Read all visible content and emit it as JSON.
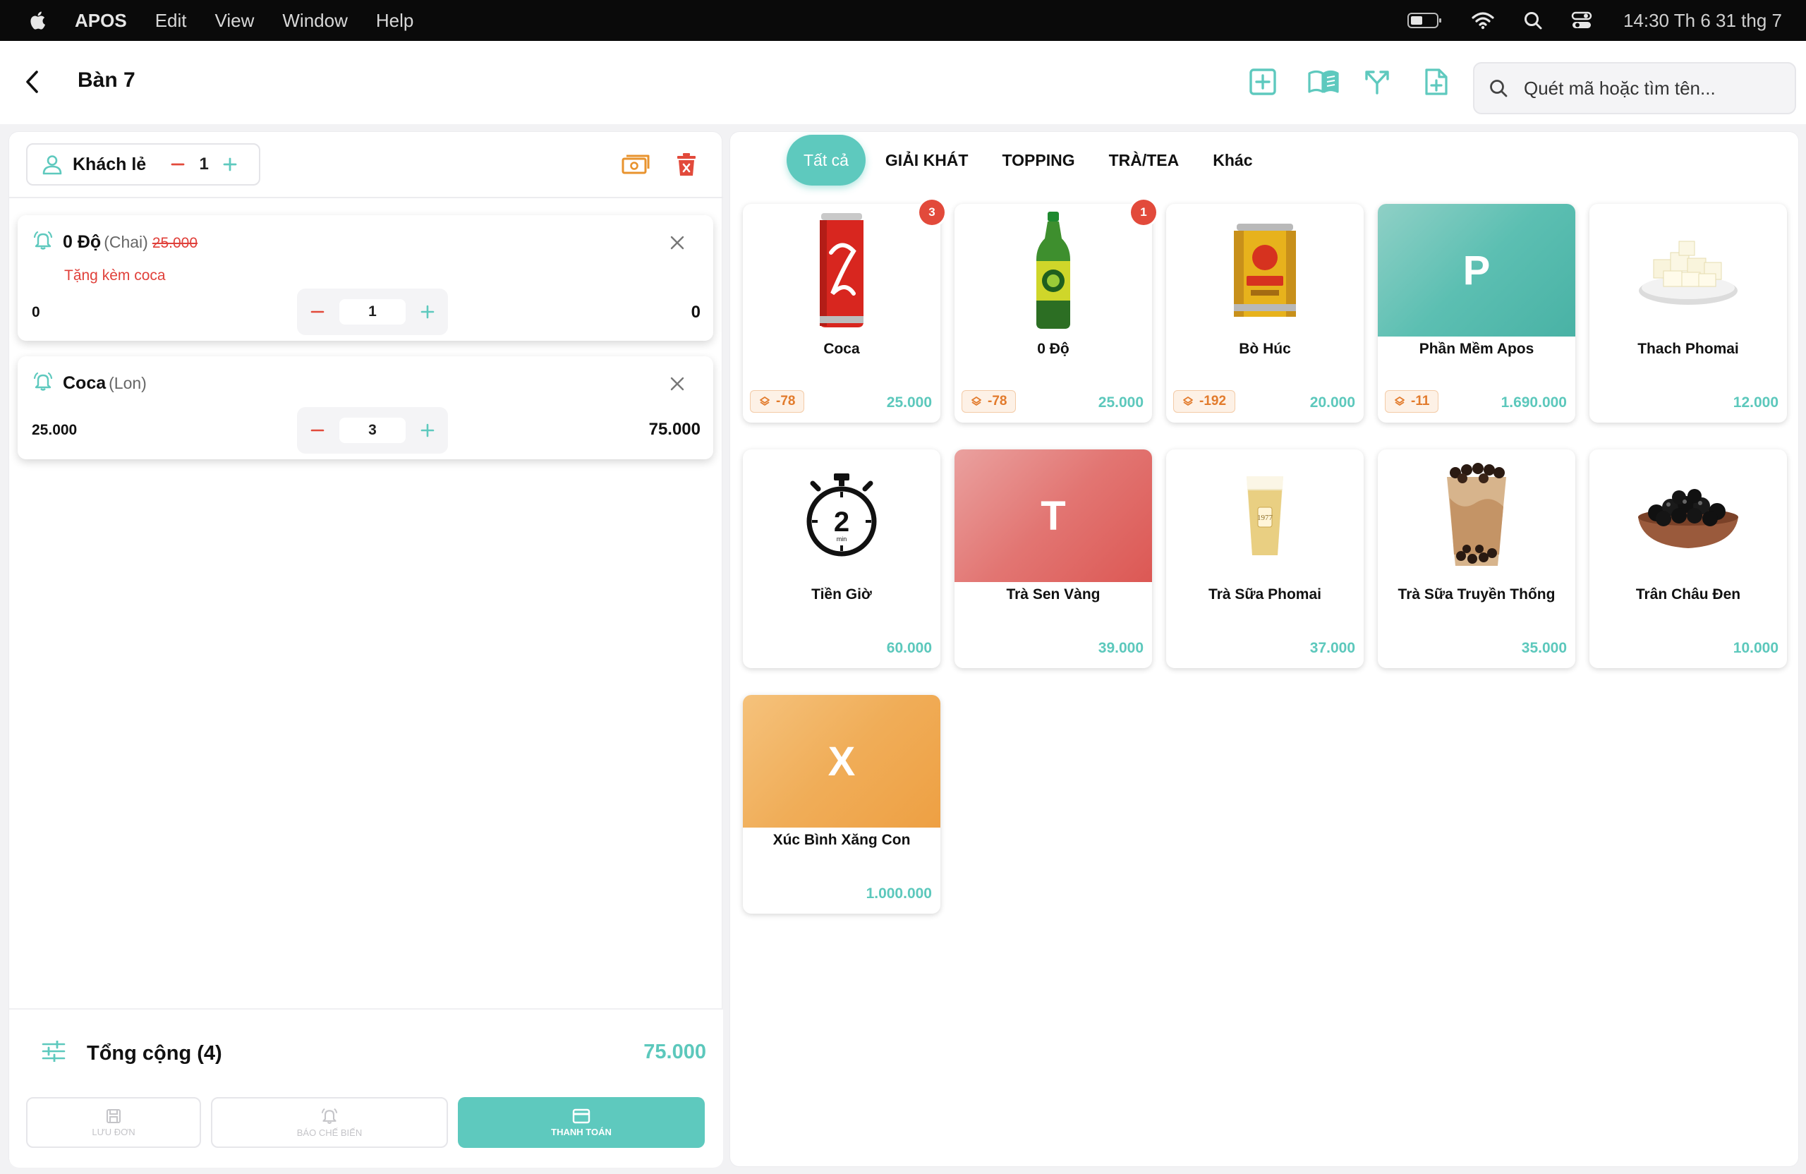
{
  "menubar": {
    "app_name": "APOS",
    "items": [
      "Edit",
      "View",
      "Window",
      "Help"
    ],
    "clock": "14:30 Th 6 31 thg 7"
  },
  "header": {
    "title": "Bàn 7",
    "search_placeholder": "Quét mã hoặc tìm tên..."
  },
  "order": {
    "customer_name": "Khách lẻ",
    "customer_count": "1",
    "items": [
      {
        "name": "0 Độ",
        "unit": "(Chai)",
        "old_price": "25.000",
        "note": "Tặng kèm coca",
        "price": "0",
        "qty": "1",
        "total": "0"
      },
      {
        "name": "Coca",
        "unit": "(Lon)",
        "price": "25.000",
        "qty": "3",
        "total": "75.000"
      }
    ],
    "total_label": "Tổng cộng (4)",
    "total_value": "75.000",
    "buttons": {
      "save": "LƯU ĐƠN",
      "kitchen": "BÁO CHẾ BIẾN",
      "pay": "THANH TOÁN"
    }
  },
  "categories": [
    "Tất cả",
    "GIẢI KHÁT",
    "TOPPING",
    "TRÀ/TEA",
    "Khác"
  ],
  "products": [
    {
      "name": "Coca",
      "price": "25.000",
      "stock": "-78",
      "badge": "3",
      "icon": "coca-can"
    },
    {
      "name": "0 Độ",
      "price": "25.000",
      "stock": "-78",
      "badge": "1",
      "icon": "green-tea-bottle"
    },
    {
      "name": "Bò Húc",
      "price": "20.000",
      "stock": "-192",
      "icon": "energy-drink-can"
    },
    {
      "name": "Phần Mềm Apos",
      "price": "1.690.000",
      "stock": "-11",
      "letter": "P",
      "color": "#5cbfb2"
    },
    {
      "name": "Thach Phomai",
      "price": "12.000",
      "icon": "cheese-jelly-bowl"
    },
    {
      "name": "Tiền Giờ",
      "price": "60.000",
      "icon": "stopwatch",
      "icon_text": "2",
      "icon_sub": "min"
    },
    {
      "name": "Trà Sen Vàng",
      "price": "39.000",
      "letter": "T",
      "color": "#e06a66"
    },
    {
      "name": "Trà Sữa Phomai",
      "price": "37.000",
      "icon": "cheese-tea-cup"
    },
    {
      "name": "Trà Sữa Truyền Thống",
      "price": "35.000",
      "icon": "bubble-tea-cup"
    },
    {
      "name": "Trân Châu Đen",
      "price": "10.000",
      "icon": "tapioca-bowl"
    },
    {
      "name": "Xúc Bình Xăng Con",
      "price": "1.000.000",
      "letter": "X",
      "color": "#f0ad58"
    }
  ],
  "colors": {
    "accent": "#5ec9be",
    "danger": "#e24a3b",
    "warning": "#e27b2c"
  }
}
